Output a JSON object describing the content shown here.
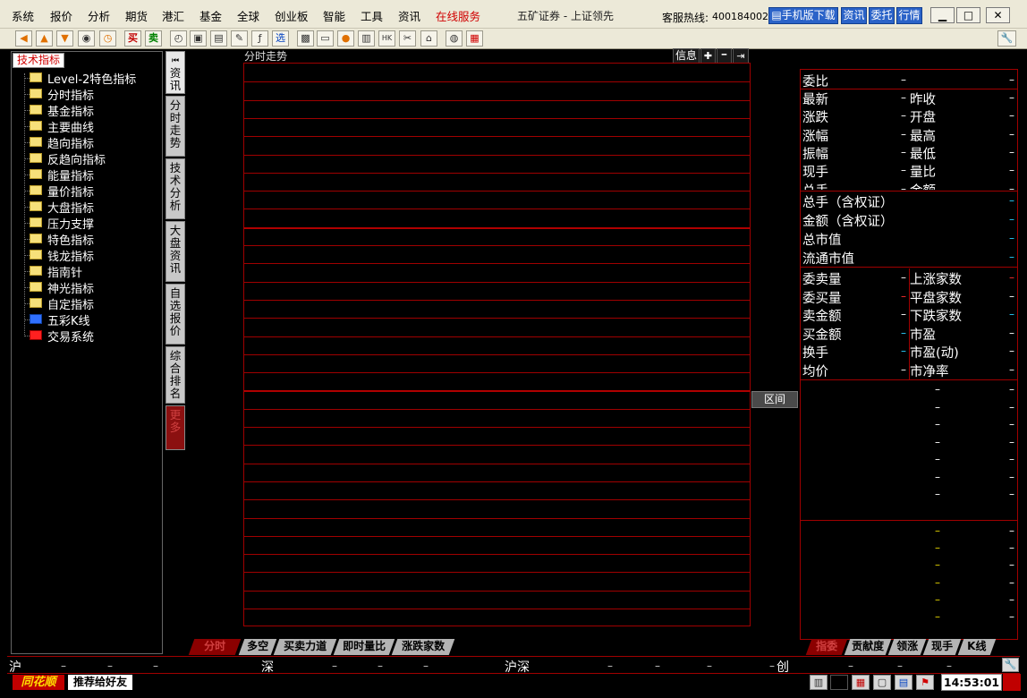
{
  "menu": {
    "items": [
      "系统",
      "报价",
      "分析",
      "期货",
      "港汇",
      "基金",
      "全球",
      "创业板",
      "智能",
      "工具",
      "资讯"
    ],
    "online_service": "在线服务",
    "app_title": "五矿证券 - 上证领先",
    "hotline_label": "客服热线:",
    "hotline_number": "4001840028",
    "mobile_download": "手机版下载",
    "news_btn": "资讯",
    "order_btn": "委托",
    "market_btn": "行情"
  },
  "toolbar": {
    "buy": "买",
    "sell": "卖",
    "select": "选"
  },
  "left_panel": {
    "tab": "技术指标",
    "items": [
      {
        "label": "Level-2特色指标",
        "icon": "folder-icon"
      },
      {
        "label": "分时指标",
        "icon": "folder-icon"
      },
      {
        "label": "基金指标",
        "icon": "folder-icon"
      },
      {
        "label": "主要曲线",
        "icon": "folder-icon"
      },
      {
        "label": "趋向指标",
        "icon": "folder-icon"
      },
      {
        "label": "反趋向指标",
        "icon": "folder-icon"
      },
      {
        "label": "能量指标",
        "icon": "folder-icon"
      },
      {
        "label": "量价指标",
        "icon": "folder-icon"
      },
      {
        "label": "大盘指标",
        "icon": "folder-icon"
      },
      {
        "label": "压力支撑",
        "icon": "folder-icon"
      },
      {
        "label": "特色指标",
        "icon": "folder-icon"
      },
      {
        "label": "钱龙指标",
        "icon": "folder-icon"
      },
      {
        "label": "指南针",
        "icon": "folder-icon"
      },
      {
        "label": "神光指标",
        "icon": "folder-icon"
      },
      {
        "label": "自定指标",
        "icon": "folder-icon"
      },
      {
        "label": "五彩K线",
        "icon": "candlestick-icon"
      },
      {
        "label": "交易系统",
        "icon": "trade-system-icon"
      }
    ]
  },
  "vtabs": [
    {
      "label": "资讯"
    },
    {
      "label": "分时走势"
    },
    {
      "label": "技术分析"
    },
    {
      "label": "大盘资讯"
    },
    {
      "label": "自选报价"
    },
    {
      "label": "综合排名"
    },
    {
      "label": "更多"
    }
  ],
  "chart": {
    "title": "分时走势",
    "info_btn": "信息",
    "plus_glyph": "✚",
    "minus_glyph": "━",
    "end_glyph": "⇥",
    "range_btn": "区间"
  },
  "bottom_tabs": [
    "分时",
    "多空",
    "买卖力道",
    "即时量比",
    "涨跌家数"
  ],
  "right_tabs": [
    "指委",
    "贡献度",
    "领涨",
    "现手",
    "K线"
  ],
  "right_panel": {
    "weibi": "委比",
    "block1_left": [
      "最新",
      "涨跌",
      "涨幅",
      "振幅",
      "现手",
      "总手"
    ],
    "block1_right": [
      "昨收",
      "开盘",
      "最高",
      "最低",
      "量比",
      "金额"
    ],
    "block2": [
      "总手（含权证）",
      "金额（含权证）",
      "总市值",
      "流通市值"
    ],
    "block3_left": [
      "委卖量",
      "委买量",
      "卖金额",
      "买金额",
      "换手",
      "均价"
    ],
    "block3_right": [
      "上涨家数",
      "平盘家数",
      "下跌家数",
      "市盈",
      "市盈(动)",
      "市净率"
    ],
    "dash": "–"
  },
  "index_bar": {
    "labels": [
      "沪",
      "深",
      "沪深",
      "创"
    ],
    "dash": "–"
  },
  "status": {
    "logo": "同花顺",
    "recommend": "推荐给好友",
    "time": "14:53:01"
  }
}
